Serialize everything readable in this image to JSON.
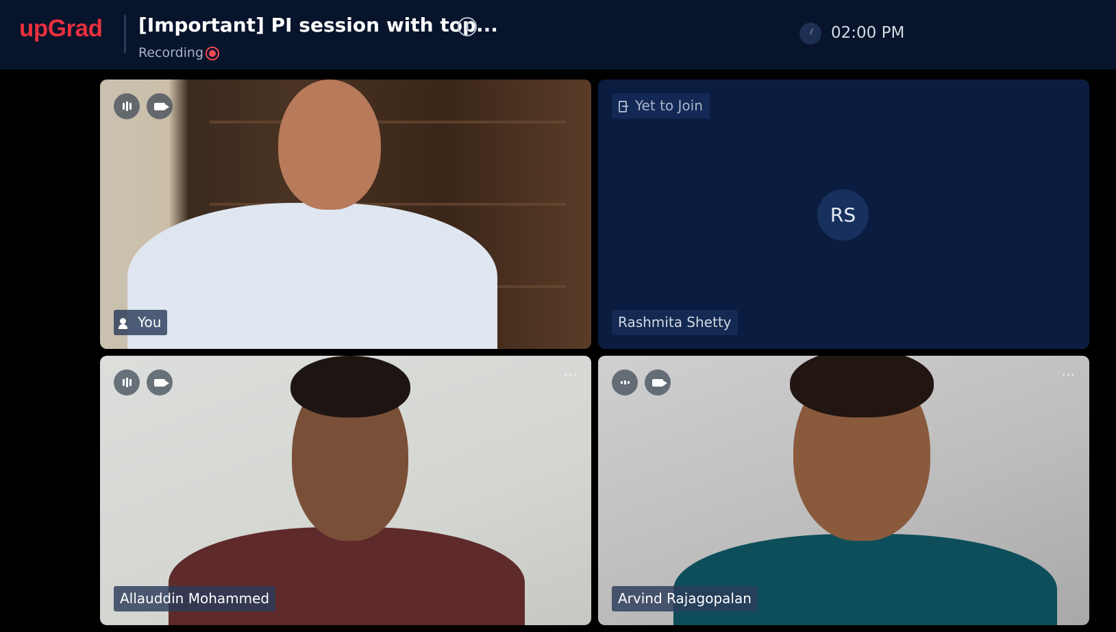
{
  "header": {
    "logo": "upGrad",
    "title": "[Important] PI session with top...",
    "recording_label": "Recording",
    "time": "02:00 PM"
  },
  "participants": [
    {
      "name": "You",
      "initials": "",
      "status": ""
    },
    {
      "name": "Rashmita Shetty",
      "initials": "RS",
      "status": "Yet to Join"
    },
    {
      "name": "Allauddin Mohammed",
      "initials": "",
      "status": ""
    },
    {
      "name": "Arvind Rajagopalan",
      "initials": "",
      "status": ""
    }
  ],
  "icons": {
    "info": "info-icon",
    "recording": "record-icon",
    "clock": "clock-icon",
    "mic": "audio-level-icon",
    "camera": "camera-icon",
    "more": "more-options-icon",
    "speaking": "speaking-user-icon",
    "join": "join-door-icon"
  },
  "colors": {
    "brand": "#e8303f",
    "header_bg": "#07142b",
    "tile_placeholder_bg": "#0a1c3f",
    "recording": "#f04a57"
  }
}
